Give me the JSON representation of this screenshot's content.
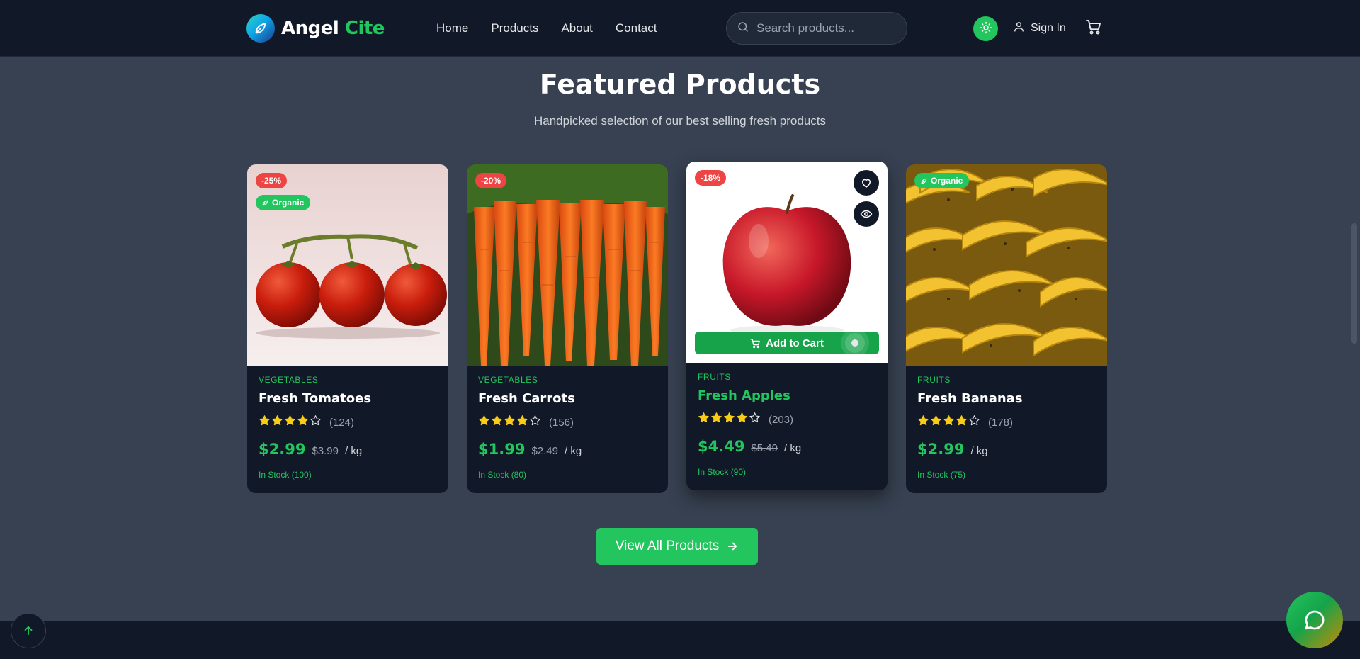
{
  "header": {
    "logo_primary": "Angel",
    "logo_secondary": "Cite",
    "nav": [
      "Home",
      "Products",
      "About",
      "Contact"
    ],
    "search_placeholder": "Search products...",
    "signin_label": "Sign In"
  },
  "section": {
    "title": "Featured Products",
    "subtitle": "Handpicked selection of our best selling fresh products"
  },
  "products": [
    {
      "discount": "-25%",
      "organic": "Organic",
      "category": "VEGETABLES",
      "name": "Fresh Tomatoes",
      "rating": 4,
      "reviews": "(124)",
      "price": "$2.99",
      "old_price": "$3.99",
      "unit": "/ kg",
      "stock": "In Stock (100)"
    },
    {
      "discount": "-20%",
      "category": "VEGETABLES",
      "name": "Fresh Carrots",
      "rating": 4,
      "reviews": "(156)",
      "price": "$1.99",
      "old_price": "$2.49",
      "unit": "/ kg",
      "stock": "In Stock (80)"
    },
    {
      "discount": "-18%",
      "category": "FRUITS",
      "name": "Fresh Apples",
      "rating": 4,
      "reviews": "(203)",
      "price": "$4.49",
      "old_price": "$5.49",
      "unit": "/ kg",
      "stock": "In Stock (90)",
      "add_to_cart": "Add to Cart"
    },
    {
      "organic": "Organic",
      "category": "FRUITS",
      "name": "Fresh Bananas",
      "rating": 4,
      "reviews": "(178)",
      "price": "$2.99",
      "unit": "/ kg",
      "stock": "In Stock (75)"
    }
  ],
  "view_all_label": "View All Products",
  "colors": {
    "accent": "#22c55e",
    "discount": "#ef4444",
    "header_bg": "#111827",
    "page_bg": "#374151",
    "star": "#facc15"
  },
  "icons": [
    "leaf-icon",
    "search-icon",
    "sun-icon",
    "user-icon",
    "cart-icon",
    "heart-icon",
    "eye-icon",
    "star-icon",
    "arrow-right-icon",
    "arrow-up-icon",
    "chat-icon"
  ]
}
